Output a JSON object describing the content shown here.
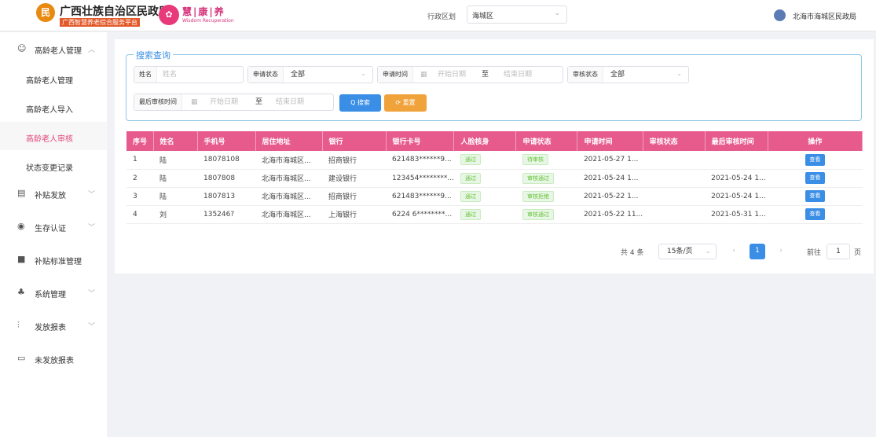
{
  "header": {
    "brand_title": "广西壮族自治区民政厅",
    "brand_sub": "广西智慧养老综合服务平台",
    "brand2_name": "慧|康|养",
    "brand2_en": "Wisdom Recuperation",
    "region_label": "行政区划",
    "region_value": "海城区",
    "user_name": "北海市海城区民政局"
  },
  "sidebar": {
    "groups": [
      {
        "label": "高龄老人管理",
        "icon": "people-icon"
      },
      {
        "label": "补贴发放",
        "icon": "bank-icon"
      },
      {
        "label": "生存认证",
        "icon": "shield-icon"
      },
      {
        "label": "补贴标准管理",
        "icon": "book-icon"
      },
      {
        "label": "系统管理",
        "icon": "users-icon"
      },
      {
        "label": "发放报表",
        "icon": "chart-icon"
      },
      {
        "label": "未发放报表",
        "icon": "report-icon"
      }
    ],
    "subs": [
      "高龄老人管理",
      "高龄老人导入",
      "高龄老人审核",
      "状态变更记录"
    ]
  },
  "search": {
    "legend": "搜索查询",
    "name_label": "姓名",
    "name_placeholder": "姓名",
    "apply_status_label": "申请状态",
    "apply_status_value": "全部",
    "apply_time_label": "申请时间",
    "start_placeholder": "开始日期",
    "to": "至",
    "end_placeholder": "结束日期",
    "review_status_label": "审核状态",
    "review_status_value": "全部",
    "last_review_label": "最后审核时间",
    "last_start_placeholder": "开始日期",
    "last_to": "至",
    "last_end_placeholder": "结束日期",
    "search_btn": "Q 搜索",
    "reset_btn": "⟳ 重置"
  },
  "table": {
    "headers": [
      "序号",
      "姓名",
      "手机号",
      "居住地址",
      "银行",
      "银行卡号",
      "人脸核身",
      "申请状态",
      "申请时间",
      "审核状态",
      "最后审核时间",
      "操作"
    ],
    "rows": [
      {
        "no": "1",
        "name": "陆",
        "phone": "18078108",
        "addr": "北海市海城区...",
        "bank": "招商银行",
        "card": "621483******9...",
        "face": "通过",
        "apply": "待审核",
        "time": "2021-05-27 1...",
        "review": "",
        "last": "",
        "op": "查看"
      },
      {
        "no": "2",
        "name": "陆",
        "phone": "1807808",
        "addr": "北海市海城区...",
        "bank": "建设银行",
        "card": "123454********...",
        "face": "通过",
        "apply": "审核通过",
        "time": "2021-05-24 1...",
        "review": "",
        "last": "2021-05-24 1...",
        "op": "查看"
      },
      {
        "no": "3",
        "name": "陆",
        "phone": "1807813",
        "addr": "北海市海城区...",
        "bank": "招商银行",
        "card": "621483******9...",
        "face": "通过",
        "apply": "审核拒绝",
        "time": "2021-05-22 1...",
        "review": "",
        "last": "2021-05-24 1...",
        "op": "查看"
      },
      {
        "no": "4",
        "name": "刘",
        "phone": "135246?",
        "addr": "北海市海城区...",
        "bank": "上海银行",
        "card": "6224 6********...",
        "face": "通过",
        "apply": "审核通过",
        "time": "2021-05-22 11...",
        "review": "",
        "last": "2021-05-31 1...",
        "op": "查看"
      }
    ]
  },
  "pager": {
    "total": "共 4 条",
    "page_size": "15条/页",
    "current": "1",
    "goto_label": "前往",
    "goto_value": "1",
    "page_unit": "页"
  }
}
